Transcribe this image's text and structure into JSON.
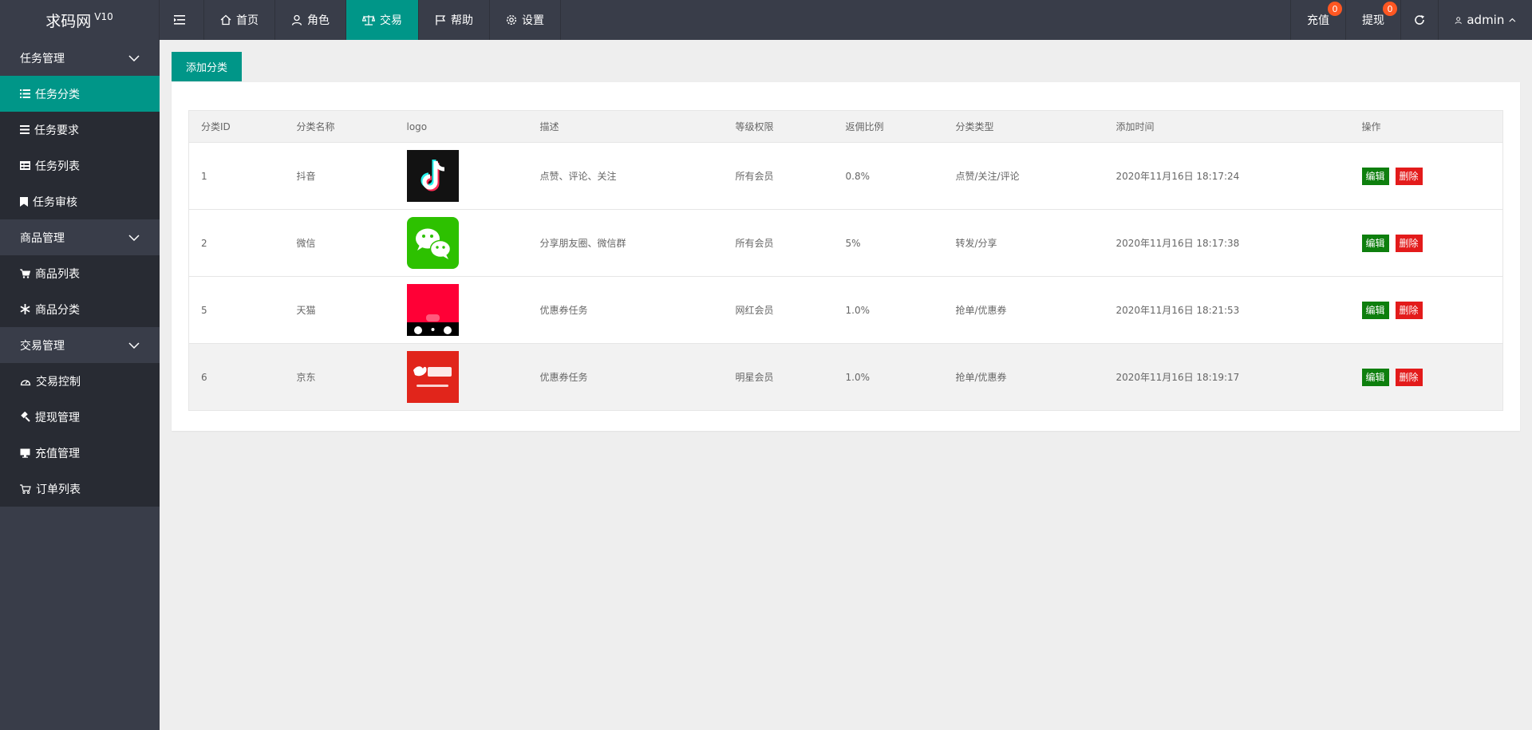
{
  "app": {
    "name": "求码网",
    "version": "V10"
  },
  "topnav": {
    "items": [
      {
        "label": "首页",
        "icon": "home-icon"
      },
      {
        "label": "角色",
        "icon": "user-icon"
      },
      {
        "label": "交易",
        "icon": "scale-icon",
        "active": true
      },
      {
        "label": "帮助",
        "icon": "flag-icon"
      },
      {
        "label": "设置",
        "icon": "gear-icon"
      }
    ],
    "recharge": {
      "label": "充值",
      "badge": "0"
    },
    "withdraw": {
      "label": "提现",
      "badge": "0"
    },
    "user": "admin"
  },
  "sidebar": {
    "groups": [
      {
        "title": "任务管理",
        "items": [
          "任务分类",
          "任务要求",
          "任务列表",
          "任务审核"
        ]
      },
      {
        "title": "商品管理",
        "items": [
          "商品列表",
          "商品分类"
        ]
      },
      {
        "title": "交易管理",
        "items": [
          "交易控制",
          "提现管理",
          "充值管理",
          "订单列表"
        ]
      }
    ],
    "active_item": "任务分类"
  },
  "main": {
    "add_button": "添加分类",
    "table": {
      "headers": [
        "分类ID",
        "分类名称",
        "logo",
        "描述",
        "等级权限",
        "返佣比例",
        "分类类型",
        "添加时间",
        "操作"
      ],
      "rows": [
        {
          "id": "1",
          "name": "抖音",
          "logo": "douyin-logo",
          "desc": "点赞、评论、关注",
          "level": "所有会员",
          "rate": "0.8%",
          "type": "点赞/关注/评论",
          "time": "2020年11月16日 18:17:24"
        },
        {
          "id": "2",
          "name": "微信",
          "logo": "wechat-logo",
          "desc": "分享朋友圈、微信群",
          "level": "所有会员",
          "rate": "5%",
          "type": "转发/分享",
          "time": "2020年11月16日 18:17:38"
        },
        {
          "id": "5",
          "name": "天猫",
          "logo": "tmall-logo",
          "desc": "优惠券任务",
          "level": "网红会员",
          "rate": "1.0%",
          "type": "抢单/优惠券",
          "time": "2020年11月16日 18:21:53"
        },
        {
          "id": "6",
          "name": "京东",
          "logo": "jd-logo",
          "desc": "优惠券任务",
          "level": "明星会员",
          "rate": "1.0%",
          "type": "抢单/优惠券",
          "time": "2020年11月16日 18:19:17"
        }
      ],
      "edit_label": "编辑",
      "delete_label": "删除"
    }
  },
  "colors": {
    "accent": "#009688",
    "topbar": "#393d49",
    "edit": "#0e7f0e",
    "delete": "#e31b1b",
    "badge": "#ff5722"
  }
}
